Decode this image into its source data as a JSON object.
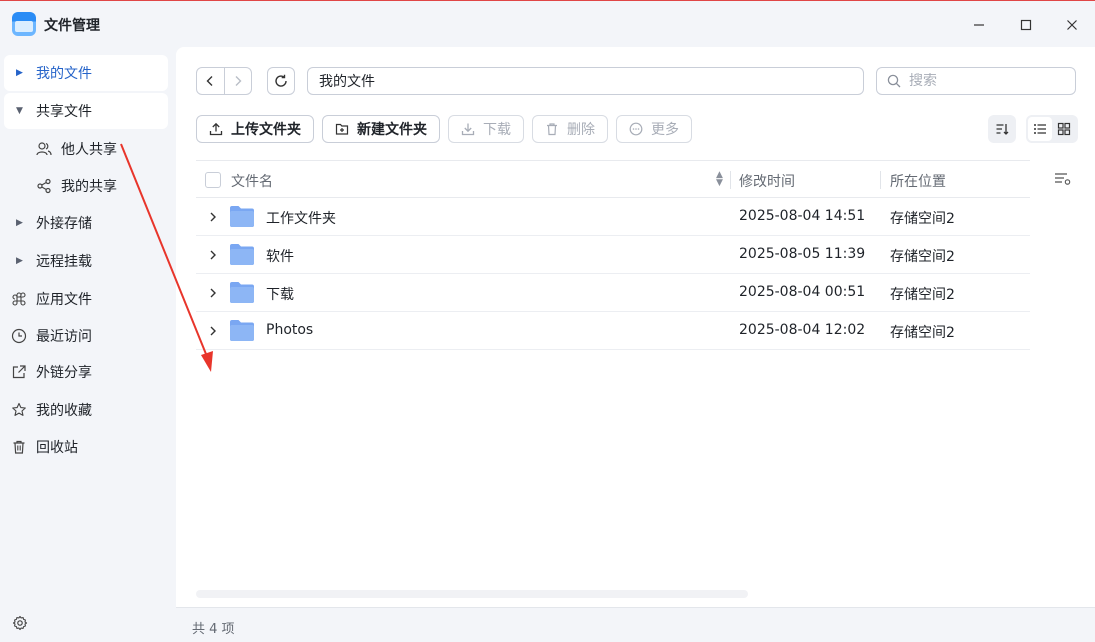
{
  "app": {
    "title": "文件管理"
  },
  "window_controls": {
    "minimize": "minimize",
    "maximize": "maximize",
    "close": "close"
  },
  "sidebar": {
    "items": [
      {
        "label": "我的文件",
        "state": "active",
        "icon": "caret-right-icon"
      },
      {
        "label": "共享文件",
        "state": "expanded",
        "icon": "caret-down-icon",
        "children": [
          {
            "label": "他人共享",
            "icon": "users-icon"
          },
          {
            "label": "我的共享",
            "icon": "share-icon"
          }
        ]
      },
      {
        "label": "外接存储",
        "icon": "caret-right-icon"
      },
      {
        "label": "远程挂载",
        "icon": "caret-right-icon"
      },
      {
        "label": "应用文件",
        "icon": "command-icon"
      },
      {
        "label": "最近访问",
        "icon": "clock-icon"
      },
      {
        "label": "外链分享",
        "icon": "external-share-icon"
      },
      {
        "label": "我的收藏",
        "icon": "star-icon"
      },
      {
        "label": "回收站",
        "icon": "trash-icon"
      }
    ],
    "settings_icon": "gear-icon"
  },
  "toolbar": {
    "path": "我的文件",
    "search_placeholder": "搜索",
    "buttons": {
      "upload": "上传文件夹",
      "new_folder": "新建文件夹",
      "download": "下载",
      "delete": "删除",
      "more": "更多"
    }
  },
  "table": {
    "columns": {
      "name": "文件名",
      "modified": "修改时间",
      "location": "所在位置"
    },
    "rows": [
      {
        "name": "工作文件夹",
        "modified": "2025-08-04 14:51",
        "location": "存储空间2"
      },
      {
        "name": "软件",
        "modified": "2025-08-05 11:39",
        "location": "存储空间2"
      },
      {
        "name": "下载",
        "modified": "2025-08-04 00:51",
        "location": "存储空间2"
      },
      {
        "name": "Photos",
        "modified": "2025-08-04 12:02",
        "location": "存储空间2"
      }
    ]
  },
  "status": {
    "count": "共 4 项"
  },
  "colors": {
    "accent": "#2563c9",
    "annotation_arrow": "#e8352b",
    "folder": "#7aa7f2"
  }
}
